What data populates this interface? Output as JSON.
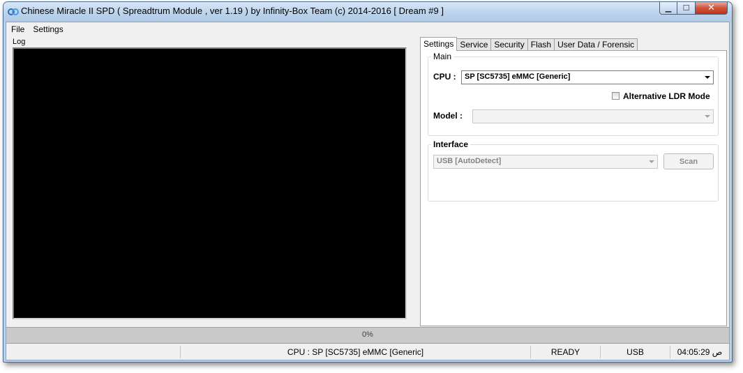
{
  "window": {
    "title": "Chinese Miracle II SPD ( Spreadtrum Module , ver 1.19 ) by Infinity-Box Team (c) 2014-2016 [ Dream #9 ]",
    "controls": {
      "minimize": "▁",
      "maximize": "☐",
      "close": "✕"
    }
  },
  "menu": {
    "items": [
      "File",
      "Settings"
    ]
  },
  "log": {
    "label": "Log"
  },
  "tabs": [
    "Settings",
    "Service",
    "Security",
    "Flash",
    "User Data / Forensic"
  ],
  "settings": {
    "main_group": "Main",
    "cpu_label": "CPU :",
    "cpu_value": "SP [SC5735] eMMC [Generic]",
    "alt_ldr_label": "Alternative LDR Mode",
    "alt_ldr_checked": false,
    "model_label": "Model :",
    "model_value": "",
    "interface_group": "Interface",
    "interface_value": "USB [AutoDetect]",
    "scan_button": "Scan"
  },
  "progress": {
    "text": "0%",
    "value": 0
  },
  "status": {
    "cpu": "CPU : SP [SC5735] eMMC [Generic]",
    "state": "READY",
    "port": "USB",
    "time": "04:05:29 ص"
  },
  "colors": {
    "log_background": "#000000",
    "titlebar": "#bcd3ec",
    "close_button": "#c2321a"
  }
}
